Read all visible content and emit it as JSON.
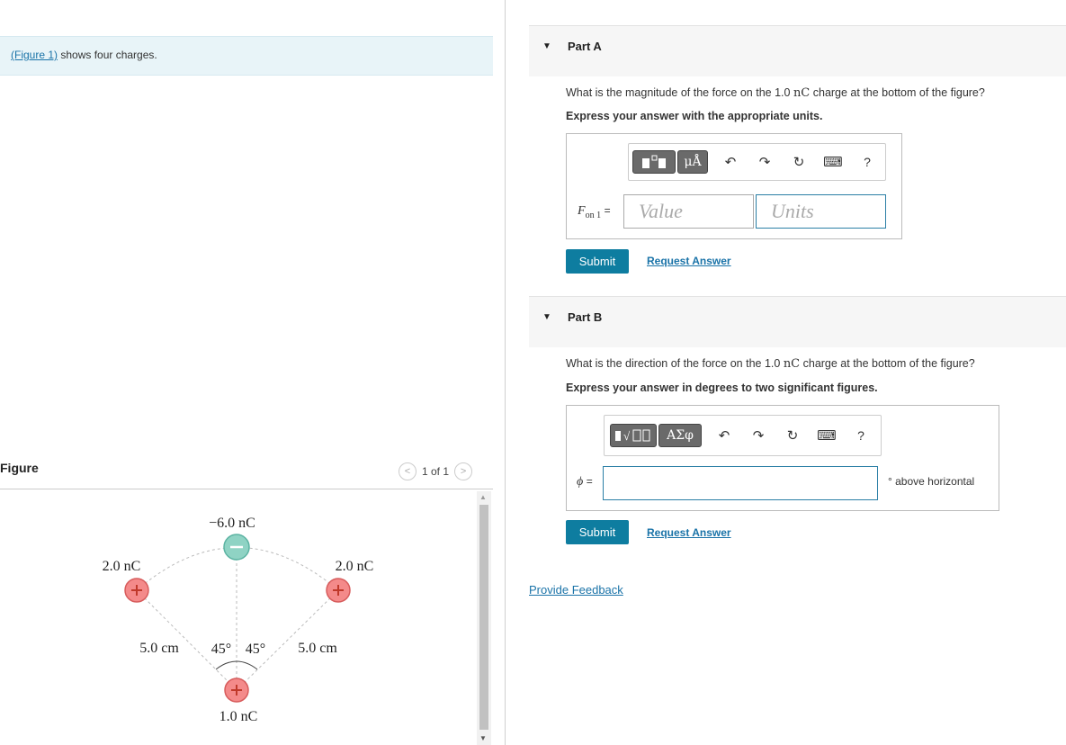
{
  "intro": {
    "figure_link": "(Figure 1)",
    "text": " shows four charges."
  },
  "figure_panel": {
    "title": "Figure",
    "pager": "1 of 1",
    "charges": {
      "top": "−6.0 nC",
      "left": "2.0 nC",
      "right": "2.0 nC",
      "bottom": "1.0 nC"
    },
    "dist_left": "5.0 cm",
    "dist_right": "5.0 cm",
    "angle_left": "45°",
    "angle_right": "45°"
  },
  "part_a": {
    "label": "Part A",
    "question_pre": "What is the magnitude of the force on the 1.0 ",
    "question_unit": "nC",
    "question_post": " charge at the bottom of the figure?",
    "instruction": "Express your answer with the appropriate units.",
    "units_symbol": "μÅ",
    "var_main": "F",
    "var_sub": "on 1",
    "equals": "=",
    "value_placeholder": "Value",
    "units_placeholder": "Units",
    "help": "?",
    "submit": "Submit",
    "request": "Request Answer"
  },
  "part_b": {
    "label": "Part B",
    "question_pre": "What is the direction of the force on the 1.0 ",
    "question_unit": "nC",
    "question_post": " charge at the bottom of the figure?",
    "instruction": "Express your answer in degrees to two significant figures.",
    "greek": "ΑΣφ",
    "var": "ϕ",
    "equals": "=",
    "suffix": "° above horizontal",
    "help": "?",
    "submit": "Submit",
    "request": "Request Answer"
  },
  "feedback": "Provide Feedback",
  "colors": {
    "accent": "#0e7da0",
    "link": "#1a73a8",
    "positive": "#f48a8a",
    "negative": "#8fd3c4"
  }
}
